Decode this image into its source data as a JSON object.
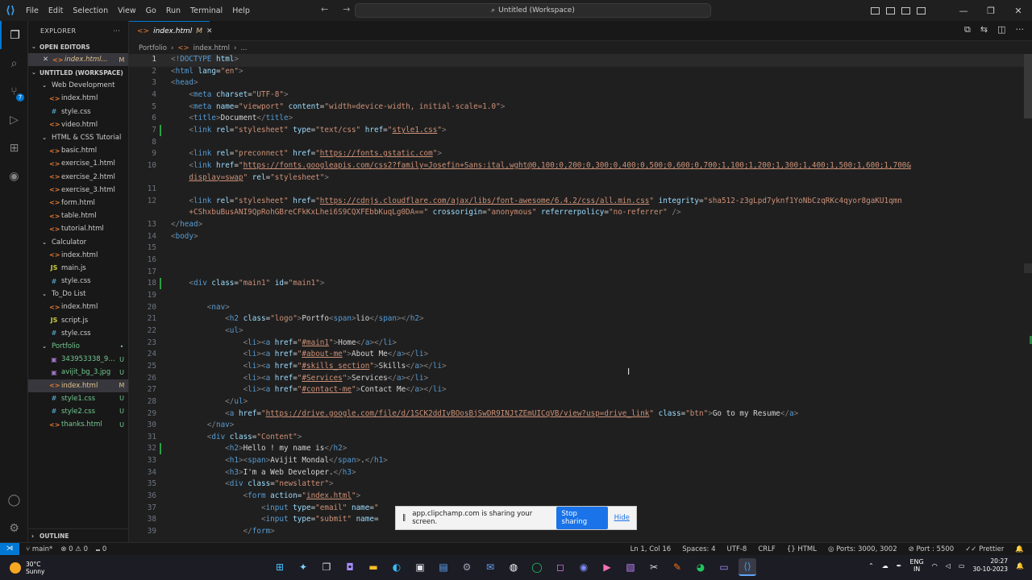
{
  "menu": [
    "File",
    "Edit",
    "Selection",
    "View",
    "Go",
    "Run",
    "Terminal",
    "Help"
  ],
  "command_center": "Untitled (Workspace)",
  "sidebar": {
    "title": "EXPLORER",
    "open_editors_label": "OPEN EDITORS",
    "open_editor_file": "index.html...",
    "open_editor_status": "M",
    "workspace_label": "UNTITLED (WORKSPACE)",
    "tree": [
      {
        "kind": "folder",
        "name": "Web Development",
        "depth": 1
      },
      {
        "kind": "html",
        "name": "index.html",
        "depth": 2
      },
      {
        "kind": "css",
        "name": "style.css",
        "depth": 2
      },
      {
        "kind": "html",
        "name": "video.html",
        "depth": 2
      },
      {
        "kind": "folder",
        "name": "HTML & CSS Tutorial",
        "depth": 1
      },
      {
        "kind": "html",
        "name": "basic.html",
        "depth": 2
      },
      {
        "kind": "html",
        "name": "exercise_1.html",
        "depth": 2
      },
      {
        "kind": "html",
        "name": "exercise_2.html",
        "depth": 2
      },
      {
        "kind": "html",
        "name": "exercise_3.html",
        "depth": 2
      },
      {
        "kind": "html",
        "name": "form.html",
        "depth": 2
      },
      {
        "kind": "html",
        "name": "table.html",
        "depth": 2
      },
      {
        "kind": "html",
        "name": "tutorial.html",
        "depth": 2
      },
      {
        "kind": "folder",
        "name": "Calculator",
        "depth": 1
      },
      {
        "kind": "html",
        "name": "index.html",
        "depth": 2
      },
      {
        "kind": "js",
        "name": "main.js",
        "depth": 2
      },
      {
        "kind": "css",
        "name": "style.css",
        "depth": 2
      },
      {
        "kind": "folder",
        "name": "To_Do List",
        "depth": 1
      },
      {
        "kind": "html",
        "name": "index.html",
        "depth": 2
      },
      {
        "kind": "js",
        "name": "script.js",
        "depth": 2
      },
      {
        "kind": "css",
        "name": "style.css",
        "depth": 2
      },
      {
        "kind": "folder",
        "name": "Portfolio",
        "depth": 1,
        "color": "green",
        "status": "•"
      },
      {
        "kind": "img",
        "name": "343953338_94...",
        "depth": 2,
        "color": "green",
        "status": "U"
      },
      {
        "kind": "img",
        "name": "avijit_bg_3.jpg",
        "depth": 2,
        "color": "green",
        "status": "U"
      },
      {
        "kind": "html",
        "name": "index.html",
        "depth": 2,
        "color": "mod",
        "status": "M",
        "selected": true
      },
      {
        "kind": "css",
        "name": "style1.css",
        "depth": 2,
        "color": "green",
        "status": "U"
      },
      {
        "kind": "css",
        "name": "style2.css",
        "depth": 2,
        "color": "green",
        "status": "U"
      },
      {
        "kind": "html",
        "name": "thanks.html",
        "depth": 2,
        "color": "green",
        "status": "U"
      }
    ],
    "outline_label": "OUTLINE"
  },
  "tab": {
    "label": "index.html",
    "status": "M"
  },
  "breadcrumb": [
    "Portfolio",
    "index.html",
    "..."
  ],
  "code_lines": [
    {
      "n": "1",
      "html": "<span class=\"p\">&lt;!</span><span class=\"t\">DOCTYPE</span> <span class=\"a\">html</span><span class=\"p\">&gt;</span>"
    },
    {
      "n": "2",
      "html": "<span class=\"p\">&lt;</span><span class=\"t\">html</span> <span class=\"a\">lang</span>=<span class=\"s\">\"en\"</span><span class=\"p\">&gt;</span>"
    },
    {
      "n": "3",
      "html": "<span class=\"p\">&lt;</span><span class=\"t\">head</span><span class=\"p\">&gt;</span>"
    },
    {
      "n": "4",
      "html": "    <span class=\"p\">&lt;</span><span class=\"t\">meta</span> <span class=\"a\">charset</span>=<span class=\"s\">\"UTF-8\"</span><span class=\"p\">&gt;</span>"
    },
    {
      "n": "5",
      "html": "    <span class=\"p\">&lt;</span><span class=\"t\">meta</span> <span class=\"a\">name</span>=<span class=\"s\">\"viewport\"</span> <span class=\"a\">content</span>=<span class=\"s\">\"width=device-width, initial-scale=1.0\"</span><span class=\"p\">&gt;</span>"
    },
    {
      "n": "6",
      "html": "    <span class=\"p\">&lt;</span><span class=\"t\">title</span><span class=\"p\">&gt;</span>Document<span class=\"p\">&lt;/</span><span class=\"t\">title</span><span class=\"p\">&gt;</span>"
    },
    {
      "n": "7",
      "html": "    <span class=\"p\">&lt;</span><span class=\"t\">link</span> <span class=\"a\">rel</span>=<span class=\"s\">\"stylesheet\"</span> <span class=\"a\">type</span>=<span class=\"s\">\"text/css\"</span> <span class=\"a\">href</span>=<span class=\"s\">\"</span><span class=\"u\">style1.css</span><span class=\"s\">\"</span><span class=\"p\">&gt;</span>"
    },
    {
      "n": "8",
      "html": ""
    },
    {
      "n": "9",
      "html": "    <span class=\"p\">&lt;</span><span class=\"t\">link</span> <span class=\"a\">rel</span>=<span class=\"s\">\"preconnect\"</span> <span class=\"a\">href</span>=<span class=\"s\">\"</span><span class=\"u\">https://fonts.gstatic.com</span><span class=\"s\">\"</span><span class=\"p\">&gt;</span>"
    },
    {
      "n": "10",
      "html": "    <span class=\"p\">&lt;</span><span class=\"t\">link</span> <span class=\"a\">href</span>=<span class=\"s\">\"</span><span class=\"u\">https://fonts.googleapis.com/css2?family=Josefin+Sans:ital,wght@0,100;0,200;0,300;0,400;0,500;0,600;0,700;1,100;1,200;1,300;1,400;1,500;1,600;1,700&amp;</span>"
    },
    {
      "n": "",
      "html": "    <span class=\"u\">display=swap</span><span class=\"s\">\"</span> <span class=\"a\">rel</span>=<span class=\"s\">\"stylesheet\"</span><span class=\"p\">&gt;</span>"
    },
    {
      "n": "11",
      "html": ""
    },
    {
      "n": "12",
      "html": "    <span class=\"p\">&lt;</span><span class=\"t\">link</span> <span class=\"a\">rel</span>=<span class=\"s\">\"stylesheet\"</span> <span class=\"a\">href</span>=<span class=\"s\">\"</span><span class=\"u\">https://cdnjs.cloudflare.com/ajax/libs/font-awesome/6.4.2/css/all.min.css</span><span class=\"s\">\"</span> <span class=\"a\">integrity</span>=<span class=\"s\">\"sha512-z3gLpd7yknf1YoNbCzqRKc4qyor8gaKU1qmn</span>"
    },
    {
      "n": "",
      "html": "    <span class=\"s\">+CShxbuBusANI9QpRohGBreCFkKxLhei6S9CQXFEbbKuqLg0DA==\"</span> <span class=\"a\">crossorigin</span>=<span class=\"s\">\"anonymous\"</span> <span class=\"a\">referrerpolicy</span>=<span class=\"s\">\"no-referrer\"</span> <span class=\"p\">/&gt;</span>"
    },
    {
      "n": "13",
      "html": "<span class=\"p\">&lt;/</span><span class=\"t\">head</span><span class=\"p\">&gt;</span>"
    },
    {
      "n": "14",
      "html": "<span class=\"p\">&lt;</span><span class=\"t\">body</span><span class=\"p\">&gt;</span>"
    },
    {
      "n": "15",
      "html": ""
    },
    {
      "n": "16",
      "html": ""
    },
    {
      "n": "17",
      "html": ""
    },
    {
      "n": "18",
      "html": "    <span class=\"p\">&lt;</span><span class=\"t\">div</span> <span class=\"a\">class</span>=<span class=\"s\">\"main1\"</span> <span class=\"a\">id</span>=<span class=\"s\">\"main1\"</span><span class=\"p\">&gt;</span>"
    },
    {
      "n": "19",
      "html": ""
    },
    {
      "n": "20",
      "html": "        <span class=\"p\">&lt;</span><span class=\"t\">nav</span><span class=\"p\">&gt;</span>"
    },
    {
      "n": "21",
      "html": "            <span class=\"p\">&lt;</span><span class=\"t\">h2</span> <span class=\"a\">class</span>=<span class=\"s\">\"logo\"</span><span class=\"p\">&gt;</span>Portfo<span class=\"p\">&lt;</span><span class=\"t\">span</span><span class=\"p\">&gt;</span>lio<span class=\"p\">&lt;/</span><span class=\"t\">span</span><span class=\"p\">&gt;&lt;/</span><span class=\"t\">h2</span><span class=\"p\">&gt;</span>"
    },
    {
      "n": "22",
      "html": "            <span class=\"p\">&lt;</span><span class=\"t\">ul</span><span class=\"p\">&gt;</span>"
    },
    {
      "n": "23",
      "html": "                <span class=\"p\">&lt;</span><span class=\"t\">li</span><span class=\"p\">&gt;&lt;</span><span class=\"t\">a</span> <span class=\"a\">href</span>=<span class=\"s\">\"</span><span class=\"u\">#main1</span><span class=\"s\">\"</span><span class=\"p\">&gt;</span>Home<span class=\"p\">&lt;/</span><span class=\"t\">a</span><span class=\"p\">&gt;&lt;/</span><span class=\"t\">li</span><span class=\"p\">&gt;</span>"
    },
    {
      "n": "24",
      "html": "                <span class=\"p\">&lt;</span><span class=\"t\">li</span><span class=\"p\">&gt;&lt;</span><span class=\"t\">a</span> <span class=\"a\">href</span>=<span class=\"s\">\"</span><span class=\"u\">#about-me</span><span class=\"s\">\"</span><span class=\"p\">&gt;</span>About Me<span class=\"p\">&lt;/</span><span class=\"t\">a</span><span class=\"p\">&gt;&lt;/</span><span class=\"t\">li</span><span class=\"p\">&gt;</span>"
    },
    {
      "n": "25",
      "html": "                <span class=\"p\">&lt;</span><span class=\"t\">li</span><span class=\"p\">&gt;&lt;</span><span class=\"t\">a</span> <span class=\"a\">href</span>=<span class=\"s\">\"</span><span class=\"u\">#skills_section</span><span class=\"s\">\"</span><span class=\"p\">&gt;</span>Skills<span class=\"p\">&lt;/</span><span class=\"t\">a</span><span class=\"p\">&gt;&lt;/</span><span class=\"t\">li</span><span class=\"p\">&gt;</span>"
    },
    {
      "n": "26",
      "html": "                <span class=\"p\">&lt;</span><span class=\"t\">li</span><span class=\"p\">&gt;&lt;</span><span class=\"t\">a</span> <span class=\"a\">href</span>=<span class=\"s\">\"</span><span class=\"u\">#Services</span><span class=\"s\">\"</span><span class=\"p\">&gt;</span>Services<span class=\"p\">&lt;/</span><span class=\"t\">a</span><span class=\"p\">&gt;&lt;/</span><span class=\"t\">li</span><span class=\"p\">&gt;</span>"
    },
    {
      "n": "27",
      "html": "                <span class=\"p\">&lt;</span><span class=\"t\">li</span><span class=\"p\">&gt;&lt;</span><span class=\"t\">a</span> <span class=\"a\">href</span>=<span class=\"s\">\"</span><span class=\"u\">#contact-me</span><span class=\"s\">\"</span><span class=\"p\">&gt;</span>Contact Me<span class=\"p\">&lt;/</span><span class=\"t\">a</span><span class=\"p\">&gt;&lt;/</span><span class=\"t\">li</span><span class=\"p\">&gt;</span>"
    },
    {
      "n": "28",
      "html": "            <span class=\"p\">&lt;/</span><span class=\"t\">ul</span><span class=\"p\">&gt;</span>"
    },
    {
      "n": "29",
      "html": "            <span class=\"p\">&lt;</span><span class=\"t\">a</span> <span class=\"a\">href</span>=<span class=\"s\">\"</span><span class=\"u\">https://drive.google.com/file/d/1SCK2ddIvBOosBjSwDR9INJtZEmUICqVB/view?usp=drive_link</span><span class=\"s\">\"</span> <span class=\"a\">class</span>=<span class=\"s\">\"btn\"</span><span class=\"p\">&gt;</span>Go to my Resume<span class=\"p\">&lt;/</span><span class=\"t\">a</span><span class=\"p\">&gt;</span>"
    },
    {
      "n": "30",
      "html": "        <span class=\"p\">&lt;/</span><span class=\"t\">nav</span><span class=\"p\">&gt;</span>"
    },
    {
      "n": "31",
      "html": "        <span class=\"p\">&lt;</span><span class=\"t\">div</span> <span class=\"a\">class</span>=<span class=\"s\">\"Content\"</span><span class=\"p\">&gt;</span>"
    },
    {
      "n": "32",
      "html": "            <span class=\"p\">&lt;</span><span class=\"t\">h2</span><span class=\"p\">&gt;</span>Hello ! my name is<span class=\"p\">&lt;/</span><span class=\"t\">h2</span><span class=\"p\">&gt;</span>"
    },
    {
      "n": "33",
      "html": "            <span class=\"p\">&lt;</span><span class=\"t\">h1</span><span class=\"p\">&gt;&lt;</span><span class=\"t\">span</span><span class=\"p\">&gt;</span>Avijit Mondal<span class=\"p\">&lt;/</span><span class=\"t\">span</span><span class=\"p\">&gt;</span>.<span class=\"p\">&lt;/</span><span class=\"t\">h1</span><span class=\"p\">&gt;</span>"
    },
    {
      "n": "34",
      "html": "            <span class=\"p\">&lt;</span><span class=\"t\">h3</span><span class=\"p\">&gt;</span>I'm a Web Developer.<span class=\"p\">&lt;/</span><span class=\"t\">h3</span><span class=\"p\">&gt;</span>"
    },
    {
      "n": "35",
      "html": "            <span class=\"p\">&lt;</span><span class=\"t\">div</span> <span class=\"a\">class</span>=<span class=\"s\">\"newslatter\"</span><span class=\"p\">&gt;</span>"
    },
    {
      "n": "36",
      "html": "                <span class=\"p\">&lt;</span><span class=\"t\">form</span> <span class=\"a\">action</span>=<span class=\"s\">\"</span><span class=\"u\">index.html</span><span class=\"s\">\"</span><span class=\"p\">&gt;</span>"
    },
    {
      "n": "37",
      "html": "                    <span class=\"p\">&lt;</span><span class=\"t\">input</span> <span class=\"a\">type</span>=<span class=\"s\">\"email\"</span> <span class=\"a\">name</span>=<span class=\"s\">\"</span>"
    },
    {
      "n": "38",
      "html": "                    <span class=\"p\">&lt;</span><span class=\"t\">input</span> <span class=\"a\">type</span>=<span class=\"s\">\"submit\"</span> <span class=\"a\">name</span>="
    },
    {
      "n": "39",
      "html": "                <span class=\"p\">&lt;/</span><span class=\"t\">form</span><span class=\"p\">&gt;</span>"
    }
  ],
  "toast": {
    "message": "app.clipchamp.com is sharing your screen.",
    "stop": "Stop sharing",
    "hide": "Hide"
  },
  "status": {
    "branch": "main*",
    "errors": "0",
    "warnings": "0",
    "ports_count": "0",
    "position": "Ln 1, Col 16",
    "spaces": "Spaces: 4",
    "encoding": "UTF-8",
    "eol": "CRLF",
    "lang": "HTML",
    "ports": "Ports: 3000, 3002",
    "port": "Port : 5500",
    "prettier": "Prettier"
  },
  "taskbar": {
    "temp": "30°C",
    "weather": "Sunny",
    "lang1": "ENG",
    "lang2": "IN",
    "time": "20:27",
    "date": "30-10-2023"
  }
}
